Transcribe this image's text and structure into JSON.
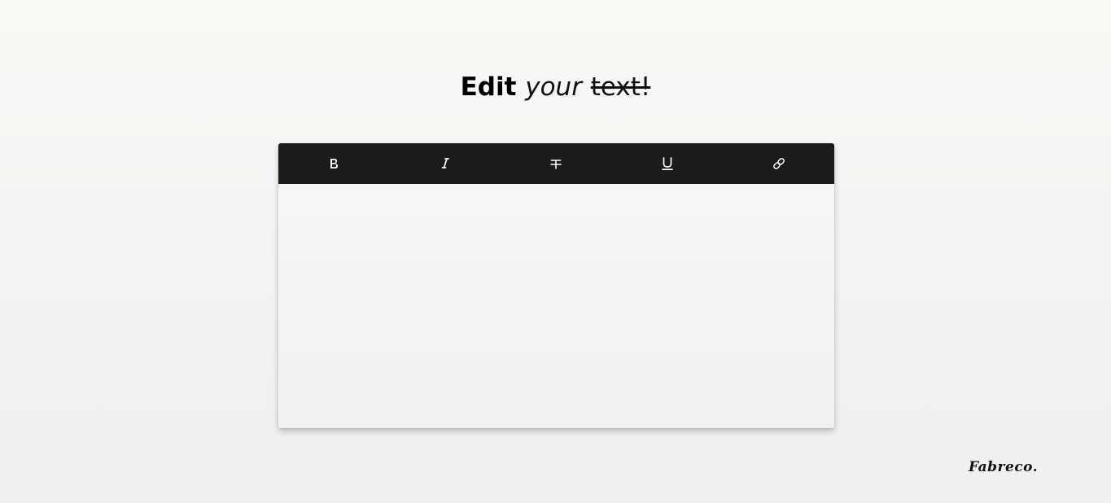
{
  "headline": {
    "bold_word": "Edit",
    "italic_word": "your",
    "strike_word": "text!"
  },
  "toolbar": {
    "buttons": [
      {
        "icon": "bold-icon"
      },
      {
        "icon": "italic-icon"
      },
      {
        "icon": "strikethrough-icon"
      },
      {
        "icon": "underline-icon"
      },
      {
        "icon": "link-icon"
      }
    ]
  },
  "editor": {
    "content": ""
  },
  "brand": {
    "name": "Fabreco."
  },
  "colors": {
    "toolbar_bg": "#1b1b1b",
    "icon": "#ffffff",
    "editor_bg": "#f4f4f4"
  }
}
